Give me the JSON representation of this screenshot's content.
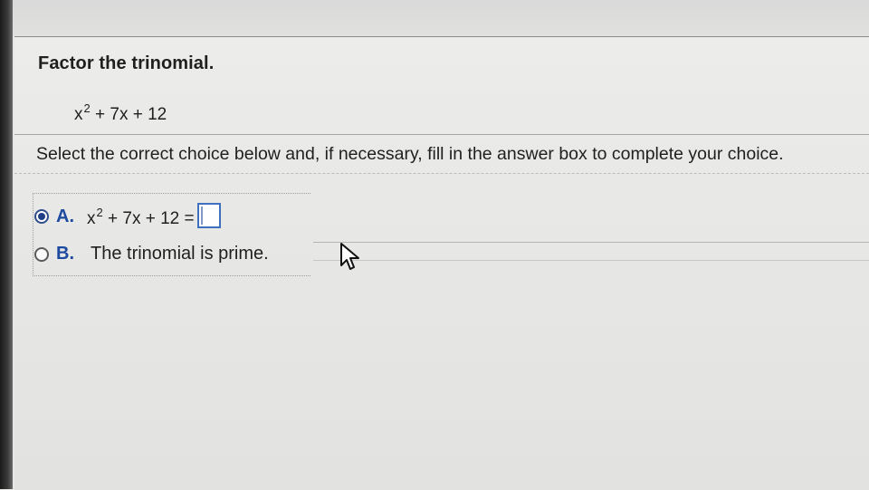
{
  "problem": {
    "title": "Factor the trinomial.",
    "expression": {
      "base": "x",
      "exponent": "2",
      "tail": " + 7x + 12"
    }
  },
  "instruction": "Select the correct choice below and, if necessary, fill in the answer box to complete your choice.",
  "choices": [
    {
      "letter": "A.",
      "selected": true,
      "expression": {
        "base": "x",
        "exponent": "2",
        "tail": " + 7x + 12 ="
      },
      "answer_value": ""
    },
    {
      "letter": "B.",
      "selected": false,
      "text": "The trinomial is prime."
    }
  ],
  "icons": {
    "radio_selected": "radio-selected-icon",
    "radio_unselected": "radio-unselected-icon",
    "pointer": "mouse-pointer-icon"
  },
  "colors": {
    "choice_letter": "#1d4aa1",
    "radio_selected": "#1f3f86",
    "answer_box_border": "#3f6fbf"
  }
}
